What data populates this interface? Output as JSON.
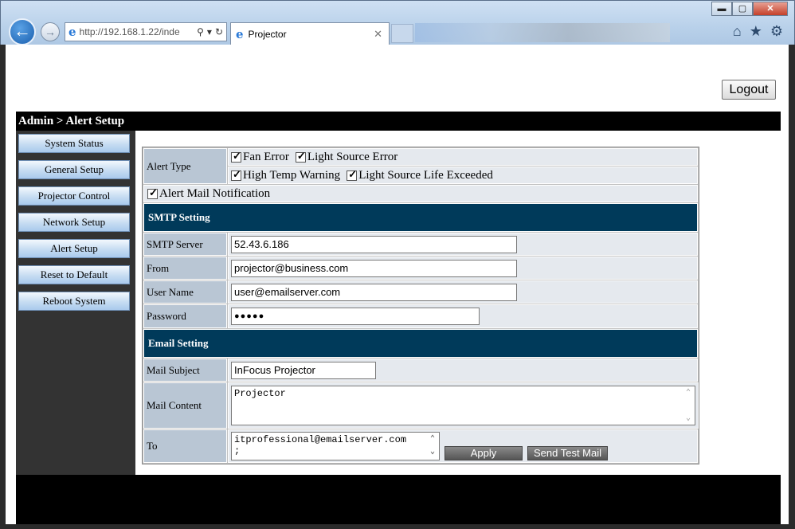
{
  "browser": {
    "address": "http://192.168.1.22/inde",
    "address_host": "192.168.1.22",
    "tab_title": "Projector",
    "window_controls": [
      "minimize-icon",
      "maximize-icon",
      "close-icon"
    ],
    "tool_icons": [
      "home-icon",
      "star-icon",
      "gear-icon"
    ]
  },
  "header": {
    "logout_label": "Logout",
    "title": "Admin > Alert Setup"
  },
  "sidebar": {
    "items": [
      {
        "label": "System Status"
      },
      {
        "label": "General Setup"
      },
      {
        "label": "Projector Control"
      },
      {
        "label": "Network Setup"
      },
      {
        "label": "Alert Setup"
      },
      {
        "label": "Reset to Default"
      },
      {
        "label": "Reboot System"
      }
    ]
  },
  "form": {
    "alert_type_label": "Alert Type",
    "alerts": [
      {
        "label": "Fan Error",
        "checked": true
      },
      {
        "label": "Light Source Error",
        "checked": true
      },
      {
        "label": "High Temp Warning",
        "checked": true
      },
      {
        "label": "Light Source Life Exceeded",
        "checked": true
      }
    ],
    "alert_mail": {
      "label": "Alert Mail Notification",
      "checked": true
    },
    "smtp_section": "SMTP Setting",
    "smtp_server_label": "SMTP Server",
    "smtp_server_value": "52.43.6.186",
    "from_label": "From",
    "from_value": "projector@business.com",
    "username_label": "User Name",
    "username_value": "user@emailserver.com",
    "password_label": "Password",
    "password_value": "●●●●●",
    "email_section": "Email Setting",
    "subject_label": "Mail Subject",
    "subject_value": "InFocus Projector",
    "content_label": "Mail Content",
    "content_value": "Projector",
    "to_label": "To",
    "to_value_line1": "itprofessional@emailserver.com",
    "to_value_line2": ";",
    "apply_label": "Apply",
    "test_label": "Send Test Mail"
  },
  "colors": {
    "section_bg": "#003a5a",
    "label_bg": "#b9c6d4",
    "value_bg": "#e5e9ee"
  }
}
